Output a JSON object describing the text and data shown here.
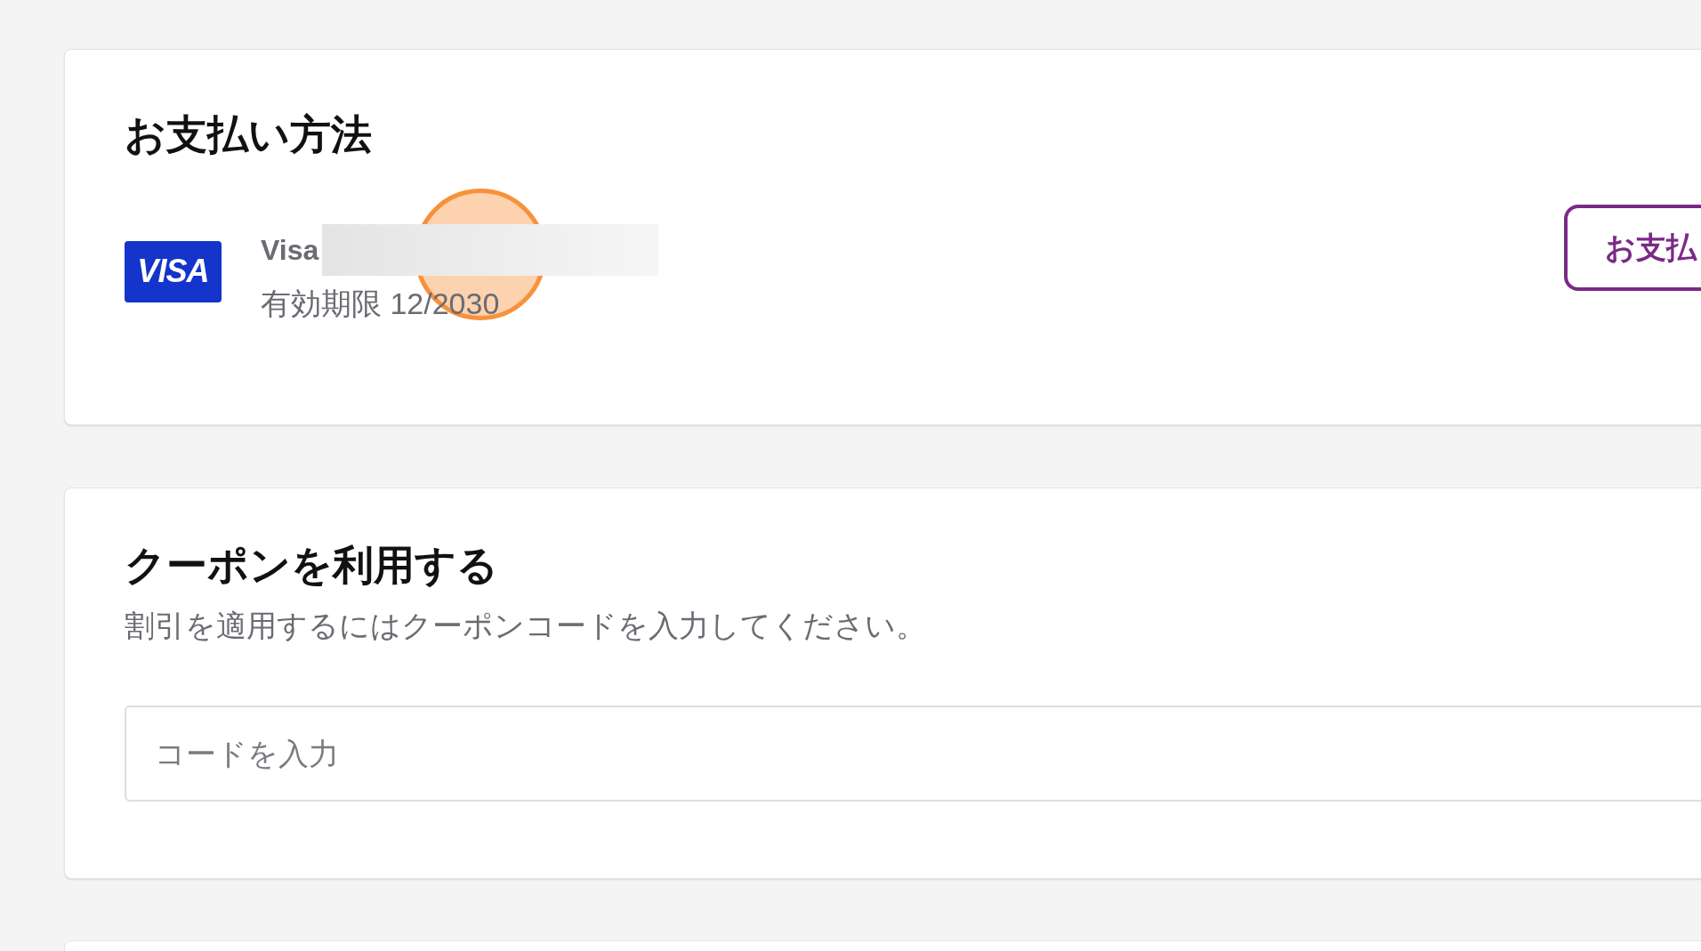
{
  "payment": {
    "title": "お支払い方法",
    "card_brand": "VISA",
    "card_name": "Visa",
    "expiry": "有効期限 12/2030",
    "button": "お支払"
  },
  "coupon": {
    "title": "クーポンを利用する",
    "description": "割引を適用するにはクーポンコードを入力してください。",
    "placeholder": "コードを入力"
  }
}
